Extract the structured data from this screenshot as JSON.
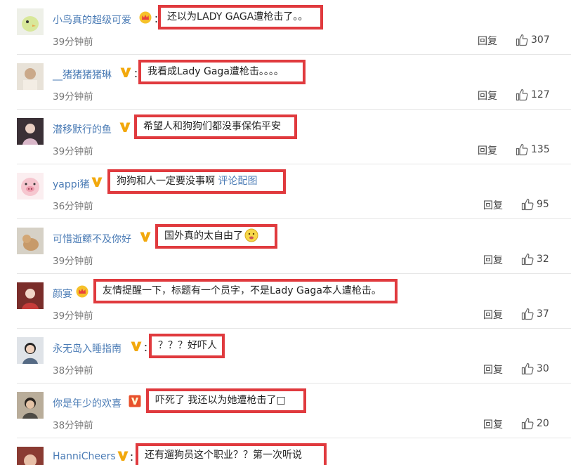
{
  "comments": [
    {
      "username": "小鸟真的超级可爱",
      "badge": "crown-icon",
      "text": "还以为LADY GAGA遭枪击了。。",
      "link": "",
      "time": "39分钟前",
      "reply": "回复",
      "likes": "307"
    },
    {
      "username": "__猪猪猪猪琳",
      "badge": "vip-v-icon",
      "text": "我看成Lady Gaga遭枪击。。。。",
      "link": "",
      "time": "39分钟前",
      "reply": "回复",
      "likes": "127"
    },
    {
      "username": "潜移默行的鱼",
      "badge": "vip-v-icon",
      "text": "希望人和狗狗们都没事保佑平安",
      "link": "",
      "time": "39分钟前",
      "reply": "回复",
      "likes": "135"
    },
    {
      "username": "yappi猪",
      "badge": "vip-v-icon",
      "text": "狗狗和人一定要没事啊",
      "link": "评论配图",
      "time": "36分钟前",
      "reply": "回复",
      "likes": "95"
    },
    {
      "username": "可惜逝鳏不及你好",
      "badge": "vip-v-icon",
      "text": "国外真的太自由了",
      "link": "",
      "time": "39分钟前",
      "reply": "回复",
      "likes": "32"
    },
    {
      "username": "颜宴",
      "badge": "crown-icon",
      "text": "友情提醒一下，标题有一个员字，不是Lady Gaga本人遭枪击。",
      "link": "",
      "time": "39分钟前",
      "reply": "回复",
      "likes": "37"
    },
    {
      "username": "永无岛入睡指南",
      "badge": "vip-v-icon",
      "text": "？？？好吓人",
      "link": "",
      "time": "38分钟前",
      "reply": "回复",
      "likes": "30"
    },
    {
      "username": "你是年少的欢喜",
      "badge": "vip-box-icon",
      "text": "吓死了 我还以为她遭枪击了□",
      "link": "",
      "time": "38分钟前",
      "reply": "回复",
      "likes": "20"
    },
    {
      "username": "HanniCheers",
      "badge": "vip-v-icon",
      "text": "还有遛狗员这个职业？？第一次听说",
      "link": "",
      "time": "",
      "reply": "",
      "likes": ""
    }
  ],
  "colors": {
    "username": "#4a7bb5",
    "highlight_border": "#e03a3e",
    "vip_badge": "#f2a80c"
  }
}
